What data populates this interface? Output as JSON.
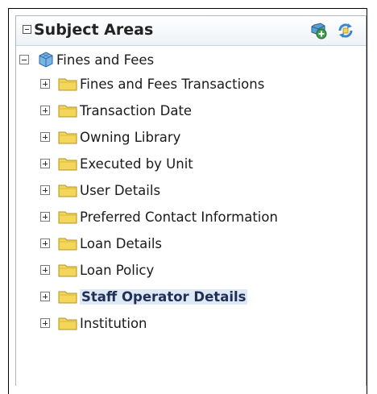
{
  "panel": {
    "title": "Subject Areas",
    "icons": [
      "add-subject-area-icon",
      "refresh-icon"
    ]
  },
  "tree": {
    "root": {
      "label": "Fines and Fees",
      "icon": "cube-icon",
      "expanded": true
    },
    "items": [
      {
        "label": "Fines and Fees Transactions"
      },
      {
        "label": "Transaction Date"
      },
      {
        "label": "Owning Library"
      },
      {
        "label": "Executed by Unit"
      },
      {
        "label": "User Details"
      },
      {
        "label": "Preferred Contact Information"
      },
      {
        "label": "Loan Details"
      },
      {
        "label": "Loan Policy"
      },
      {
        "label": "Staff Operator Details",
        "selected": true
      },
      {
        "label": "Institution"
      }
    ]
  },
  "colors": {
    "folder": "#f3d65a",
    "selected_text": "#1f2f55",
    "selected_bg": "#dfe8f5"
  }
}
